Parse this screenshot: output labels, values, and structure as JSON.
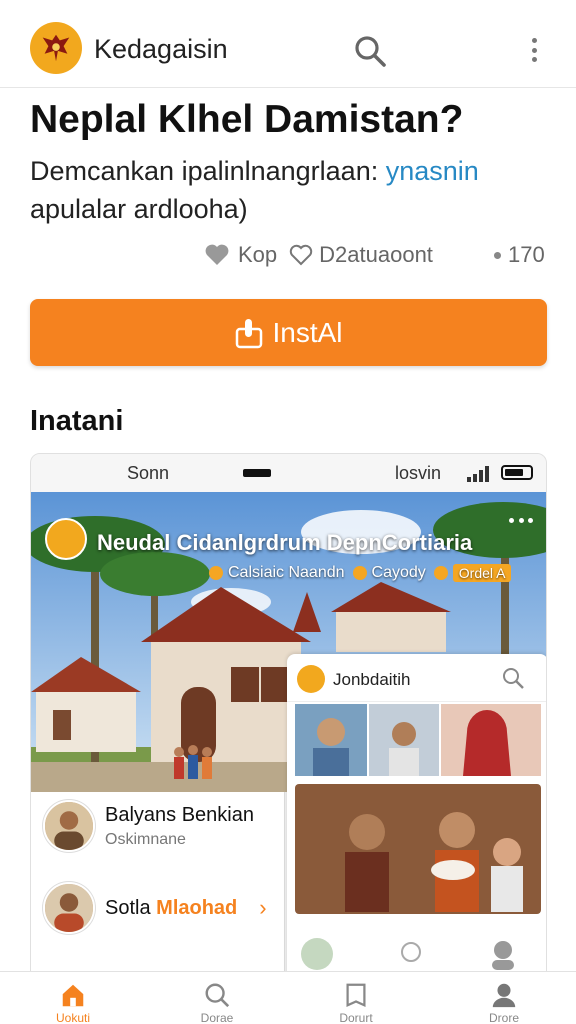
{
  "app": {
    "title": "Kedagaisin",
    "icons": {
      "logo": "garuda-emblem-icon",
      "search": "search-icon",
      "more": "more-vertical-icon"
    }
  },
  "listing": {
    "title": "Neplal Klhel Damistan?",
    "subtitle_main": "Demcankan ipalinlnangrlaan: ",
    "subtitle_link": "ynasnin",
    "subtitle_line2": "apulalar ardlooha)",
    "meta_label_1": "Kop",
    "meta_label_2": "D2atuaoont",
    "rating": "170"
  },
  "install": {
    "label": "InstAl",
    "icon": "hand-tap-icon"
  },
  "screenshots": {
    "section_title": "Inatani",
    "status_left": "Sonn",
    "status_right": "losvin",
    "hero_title": "Neudal Cidanlgrdrum DepnCortiaria",
    "hero_tag_1": "Calsiaic Naandn",
    "hero_tag_2": "Cayody",
    "hero_tag_3": "Ordel A",
    "person_1_name": "Balyans Benkian",
    "person_1_sub": "Oskimnane",
    "person_2_name_a": "Sotla ",
    "person_2_name_b": "Mlaohad",
    "card_title": "Jonbdaitih"
  },
  "colors": {
    "accent": "#f5821f",
    "link": "#2789c4",
    "emblem": "#f2a81e"
  },
  "bottom_nav": [
    {
      "label": "Uokuti",
      "icon": "home-icon",
      "active": true
    },
    {
      "label": "Dorae",
      "icon": "search-icon",
      "active": false
    },
    {
      "label": "Dorurt",
      "icon": "library-icon",
      "active": false
    },
    {
      "label": "Drore",
      "icon": "profile-icon",
      "active": false
    }
  ]
}
